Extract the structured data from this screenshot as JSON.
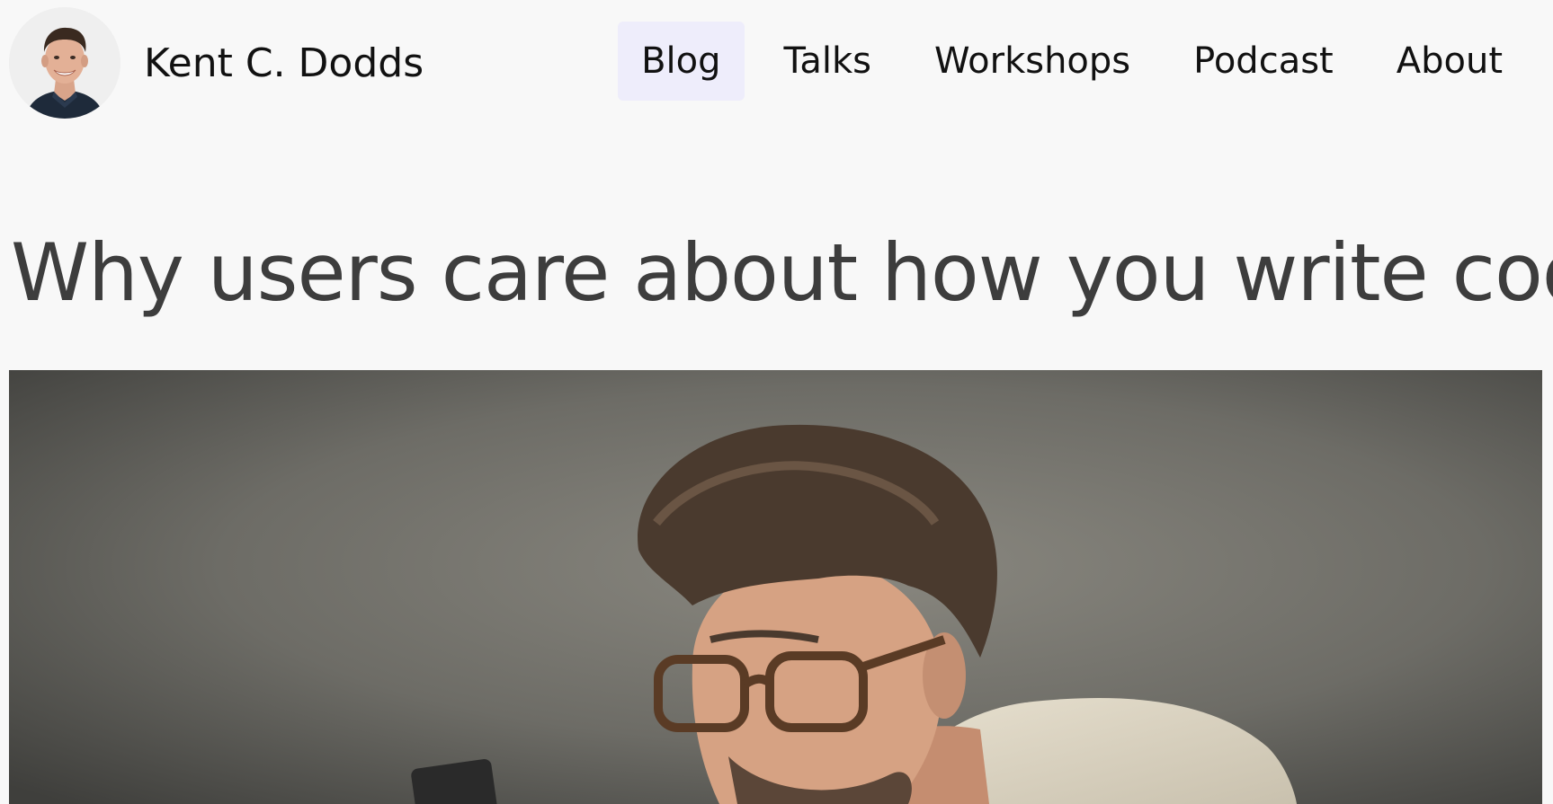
{
  "site": {
    "name": "Kent C. Dodds",
    "avatar_alt": "Kent C. Dodds"
  },
  "nav": {
    "items": [
      {
        "label": "Blog",
        "active": true
      },
      {
        "label": "Talks",
        "active": false
      },
      {
        "label": "Workshops",
        "active": false
      },
      {
        "label": "Podcast",
        "active": false
      },
      {
        "label": "About",
        "active": false
      }
    ]
  },
  "article": {
    "title": "Why users care about how you write code"
  },
  "colors": {
    "background": "#f8f8f8",
    "nav_active_bg": "#eeedfb",
    "title_text": "#3d3d3d",
    "brand_text": "#111111"
  }
}
